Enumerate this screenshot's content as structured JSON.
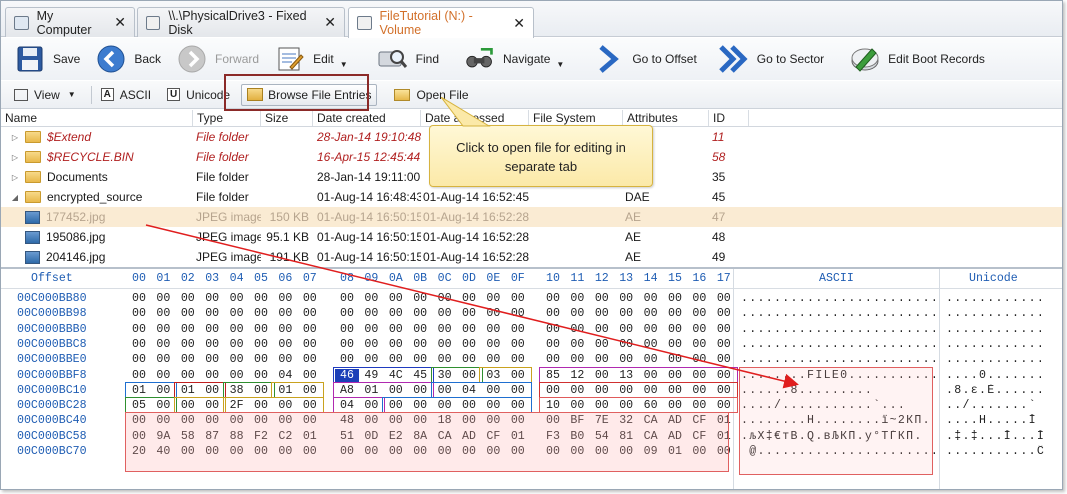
{
  "tabs": [
    {
      "label": "My Computer",
      "active": false
    },
    {
      "label": "\\\\.\\PhysicalDrive3 - Fixed Disk",
      "active": false
    },
    {
      "label": "FileTutorial (N:) - Volume",
      "active": true
    }
  ],
  "toolbar": {
    "save": "Save",
    "back": "Back",
    "forward": "Forward",
    "edit": "Edit",
    "find": "Find",
    "navigate": "Navigate",
    "goto_offset": "Go to Offset",
    "goto_sector": "Go to Sector",
    "edit_boot": "Edit Boot Records"
  },
  "subbar": {
    "view": "View",
    "ascii": "ASCII",
    "unicode": "Unicode",
    "browse": "Browse File Entries",
    "open_file": "Open File"
  },
  "file_columns": [
    "Name",
    "Type",
    "Size",
    "Date created",
    "Date accessed",
    "File System",
    "Attributes",
    "ID"
  ],
  "files": [
    {
      "name": "$Extend",
      "type": "File folder",
      "size": "",
      "created": "28-Jan-14 19:10:48",
      "accessed": "",
      "fs": "",
      "attr": "",
      "id": "11",
      "kind": "folder",
      "style": "red"
    },
    {
      "name": "$RECYCLE.BIN",
      "type": "File folder",
      "size": "",
      "created": "16-Apr-15 12:45:44",
      "accessed": "",
      "fs": "",
      "attr": "",
      "id": "58",
      "kind": "folder",
      "style": "red"
    },
    {
      "name": "Documents",
      "type": "File folder",
      "size": "",
      "created": "28-Jan-14 19:11:00",
      "accessed": "",
      "fs": "",
      "attr": "",
      "id": "35",
      "kind": "folder",
      "style": "normal"
    },
    {
      "name": "encrypted_source",
      "type": "File folder",
      "size": "",
      "created": "01-Aug-14 16:48:43",
      "accessed": "01-Aug-14 16:52:45",
      "fs": "",
      "attr": "DAE",
      "id": "45",
      "kind": "folder-open",
      "style": "normal"
    },
    {
      "name": "177452.jpg",
      "type": "JPEG image",
      "size": "150 KB",
      "created": "01-Aug-14 16:50:15",
      "accessed": "01-Aug-14 16:52:28",
      "fs": "",
      "attr": "AE",
      "id": "47",
      "kind": "image",
      "style": "sel"
    },
    {
      "name": "195086.jpg",
      "type": "JPEG image",
      "size": "95.1 KB",
      "created": "01-Aug-14 16:50:15",
      "accessed": "01-Aug-14 16:52:28",
      "fs": "",
      "attr": "AE",
      "id": "48",
      "kind": "image",
      "style": "normal"
    },
    {
      "name": "204146.jpg",
      "type": "JPEG image",
      "size": "191 KB",
      "created": "01-Aug-14 16:50:15",
      "accessed": "01-Aug-14 16:52:28",
      "fs": "",
      "attr": "AE",
      "id": "49",
      "kind": "image",
      "style": "normal"
    }
  ],
  "callout": {
    "line1": "Click to open file for editing in",
    "line2": "separate tab"
  },
  "hex": {
    "offset_label": "Offset",
    "col_headers": [
      "00",
      "01",
      "02",
      "03",
      "04",
      "05",
      "06",
      "07",
      "08",
      "09",
      "0A",
      "0B",
      "0C",
      "0D",
      "0E",
      "0F",
      "10",
      "11",
      "12",
      "13",
      "14",
      "15",
      "16",
      "17"
    ],
    "ascii_label": "ASCII",
    "unicode_label": "Unicode",
    "rows": [
      {
        "offset": "00C000BB80",
        "bytes": [
          "00",
          "00",
          "00",
          "00",
          "00",
          "00",
          "00",
          "00",
          "00",
          "00",
          "00",
          "00",
          "00",
          "00",
          "00",
          "00",
          "00",
          "00",
          "00",
          "00",
          "00",
          "00",
          "00",
          "00"
        ],
        "ascii": "........................",
        "unicode": "............"
      },
      {
        "offset": "00C000BB98",
        "bytes": [
          "00",
          "00",
          "00",
          "00",
          "00",
          "00",
          "00",
          "00",
          "00",
          "00",
          "00",
          "00",
          "00",
          "00",
          "00",
          "00",
          "00",
          "00",
          "00",
          "00",
          "00",
          "00",
          "00",
          "00"
        ],
        "ascii": "........................",
        "unicode": "............"
      },
      {
        "offset": "00C000BBB0",
        "bytes": [
          "00",
          "00",
          "00",
          "00",
          "00",
          "00",
          "00",
          "00",
          "00",
          "00",
          "00",
          "00",
          "00",
          "00",
          "00",
          "00",
          "00",
          "00",
          "00",
          "00",
          "00",
          "00",
          "00",
          "00"
        ],
        "ascii": "........................",
        "unicode": "............"
      },
      {
        "offset": "00C000BBC8",
        "bytes": [
          "00",
          "00",
          "00",
          "00",
          "00",
          "00",
          "00",
          "00",
          "00",
          "00",
          "00",
          "00",
          "00",
          "00",
          "00",
          "00",
          "00",
          "00",
          "00",
          "00",
          "00",
          "00",
          "00",
          "00"
        ],
        "ascii": "........................",
        "unicode": "............"
      },
      {
        "offset": "00C000BBE0",
        "bytes": [
          "00",
          "00",
          "00",
          "00",
          "00",
          "00",
          "00",
          "00",
          "00",
          "00",
          "00",
          "00",
          "00",
          "00",
          "00",
          "00",
          "00",
          "00",
          "00",
          "00",
          "00",
          "00",
          "00",
          "00"
        ],
        "ascii": "........................",
        "unicode": "............"
      },
      {
        "offset": "00C000BBF8",
        "bytes": [
          "00",
          "00",
          "00",
          "00",
          "00",
          "00",
          "04",
          "00",
          "46",
          "49",
          "4C",
          "45",
          "30",
          "00",
          "03",
          "00",
          "85",
          "12",
          "00",
          "13",
          "00",
          "00",
          "00",
          "00"
        ],
        "ascii": "........FILE0...........",
        "unicode": "....0......."
      },
      {
        "offset": "00C000BC10",
        "bytes": [
          "01",
          "00",
          "01",
          "00",
          "38",
          "00",
          "01",
          "00",
          "A8",
          "01",
          "00",
          "00",
          "00",
          "04",
          "00",
          "00",
          "00",
          "00",
          "00",
          "00",
          "00",
          "00",
          "00",
          "00"
        ],
        "ascii": "......8.........",
        "unicode": ".8.ε.È......"
      },
      {
        "offset": "00C000BC28",
        "bytes": [
          "05",
          "00",
          "00",
          "00",
          "2F",
          "00",
          "00",
          "00",
          "04",
          "00",
          "00",
          "00",
          "00",
          "00",
          "00",
          "00",
          "10",
          "00",
          "00",
          "00",
          "60",
          "00",
          "00",
          "00"
        ],
        "ascii": "..../...........`...",
        "unicode": "../.......`"
      },
      {
        "offset": "00C000BC40",
        "bytes": [
          "00",
          "00",
          "00",
          "00",
          "00",
          "00",
          "00",
          "00",
          "48",
          "00",
          "00",
          "00",
          "18",
          "00",
          "00",
          "00",
          "00",
          "BF",
          "7E",
          "32",
          "CA",
          "AD",
          "CF",
          "01"
        ],
        "ascii": "........H........ї~2КП.",
        "unicode": "....H.....Ĭ"
      },
      {
        "offset": "00C000BC58",
        "bytes": [
          "00",
          "9A",
          "58",
          "87",
          "88",
          "F2",
          "C2",
          "01",
          "51",
          "0D",
          "E2",
          "8A",
          "CA",
          "AD",
          "CF",
          "01",
          "F3",
          "B0",
          "54",
          "81",
          "CA",
          "AD",
          "CF",
          "01"
        ],
        "ascii": ".љX‡€тВ.Q.вЉКП.у°TЃКП.",
        "unicode": ".‡.‡...Ĭ...Ĭ"
      },
      {
        "offset": "00C000BC70",
        "bytes": [
          "20",
          "40",
          "00",
          "00",
          "00",
          "00",
          "00",
          "00",
          "00",
          "00",
          "00",
          "00",
          "00",
          "00",
          "00",
          "00",
          "00",
          "00",
          "00",
          "00",
          "09",
          "01",
          "00",
          "00"
        ],
        "ascii": " @......................",
        "unicode": "...........Ĉ"
      }
    ]
  },
  "colors": {
    "accent_orange": "#d2702a",
    "offset_blue": "#1f5db3",
    "annotation_red": "#8b2a28",
    "arrow_red": "#e01e1e",
    "callout_yellow": "#fbe9a8"
  }
}
